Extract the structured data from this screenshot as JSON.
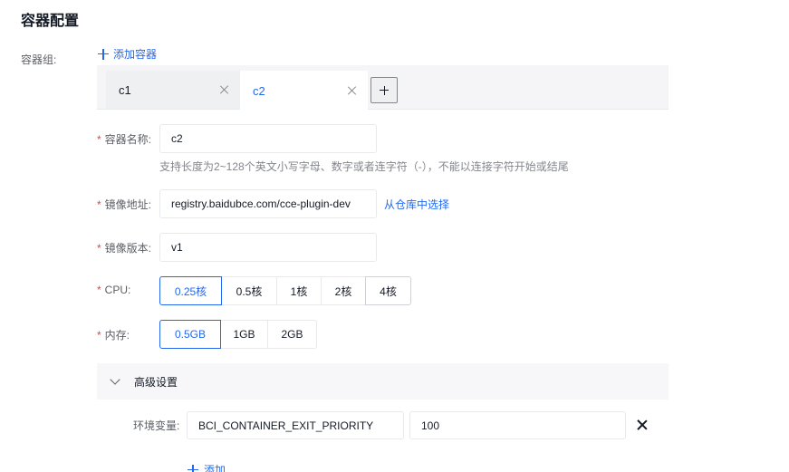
{
  "section_title": "容器配置",
  "group_label": "容器组:",
  "add_container_label": "添加容器",
  "tabs": [
    {
      "label": "c1",
      "active": false
    },
    {
      "label": "c2",
      "active": true
    }
  ],
  "form": {
    "name": {
      "label": "容器名称:",
      "value": "c2",
      "hint": "支持长度为2~128个英文小写字母、数字或者连字符（-），不能以连接字符开始或结尾"
    },
    "image": {
      "label": "镜像地址:",
      "value": "registry.baidubce.com/cce-plugin-dev",
      "link": "从仓库中选择"
    },
    "version": {
      "label": "镜像版本:",
      "value": "v1"
    },
    "cpu": {
      "label": "CPU:",
      "options": [
        "0.25核",
        "0.5核",
        "1核",
        "2核",
        "4核"
      ],
      "selected": "0.25核"
    },
    "memory": {
      "label": "内存:",
      "options": [
        "0.5GB",
        "1GB",
        "2GB"
      ],
      "selected": "0.5GB"
    }
  },
  "advanced": {
    "title": "高级设置",
    "env_label": "环境变量:",
    "env_key": "BCI_CONTAINER_EXIT_PRIORITY",
    "env_value": "100",
    "add_label": "添加"
  },
  "colors": {
    "accent": "#2468f2",
    "required": "#f33e3e"
  }
}
